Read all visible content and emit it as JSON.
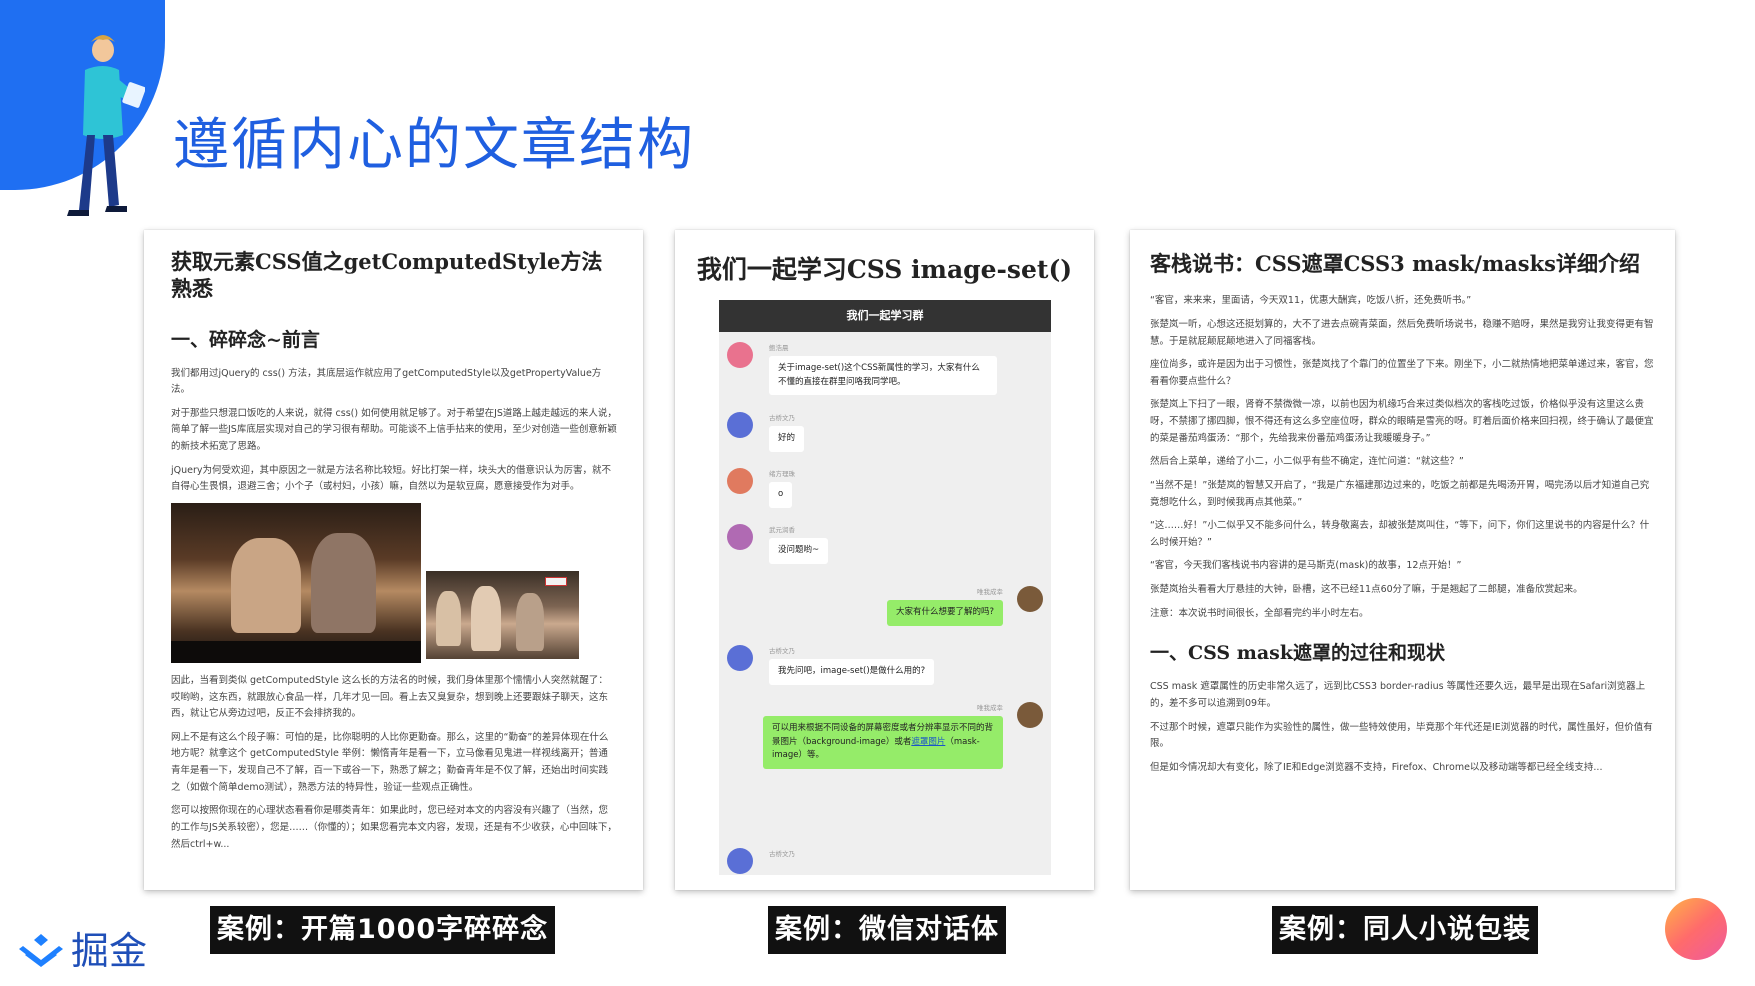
{
  "slide": {
    "title": "遵循内心的文章结构",
    "logo_text": "掘金"
  },
  "card1": {
    "title": "获取元素CSS值之getComputedStyle方法熟悉",
    "heading": "一、碎碎念~前言",
    "paragraphs": [
      "我们都用过jQuery的 css() 方法，其底层运作就应用了getComputedStyle以及getPropertyValue方法。",
      "对于那些只想混口饭吃的人来说，就得 css() 如何使用就足够了。对于希望在JS道路上越走越远的来人说，简单了解一些JS库底层实现对自己的学习很有帮助。可能谈不上信手拈来的使用，至少对创造一些创意新颖的新技术拓宽了思路。",
      "jQuery为何受欢迎，其中原因之一就是方法名称比较短。好比打架一样，块头大的借意识认为厉害，就不自得心生畏惧，退避三舍；小个子（或村妇，小孩）嘛，自然以为是软豆腐，愿意接受作为对手。",
      "因此，当看到类似 getComputedStyle 这么长的方法名的时候，我们身体里那个懦懦小人突然就醒了：哎哟哟，这东西，就跟放心食品一样，几年才见一回。看上去又臭复杂，想到晚上还要跟妹子聊天，这东西，就让它从旁边过吧，反正不会排挤我的。",
      "网上不是有这么个段子嘛：可怕的是，比你聪明的人比你更勤奋。那么，这里的“勤奋”的差异体现在什么地方呢？就拿这个 getComputedStyle 举例：懒惰青年是看一下，立马像看见鬼进一样视线离开；普通青年是看一下，发现自己不了解，百一下或谷一下，熟悉了解之；勤奋青年是不仅了解，还始出时间实践之（如做个简单demo测试），熟悉方法的特异性，验证一些观点正确性。",
      "您可以按照你现在的心理状态看看你是哪类青年：如果此时，您已经对本文的内容没有兴趣了（当然，您的工作与JS关系较密），您是……（你懂的）；如果您看完本文内容，发现，还是有不少收获，心中回味下，然后ctrl+w..."
    ]
  },
  "card2": {
    "title": "我们一起学习CSS image-set()",
    "chat_header": "我们一起学习群",
    "messages": [
      {
        "side": "left",
        "nick": "鲍浩晨",
        "text": "关于image-set()这个CSS新属性的学习，大家有什么不懂的直接在群里问咯我同学吧。",
        "color": "#e9728e"
      },
      {
        "side": "left",
        "nick": "古桥文乃",
        "text": "好的",
        "color": "#5a6fd6"
      },
      {
        "side": "left",
        "nick": "绪方理珠",
        "text": "o",
        "color": "#e07a5f"
      },
      {
        "side": "left",
        "nick": "武元润香",
        "text": "没问题哟~",
        "color": "#b06ab3"
      },
      {
        "side": "right",
        "nick": "唯我成幸",
        "text": "大家有什么想要了解的吗?",
        "color": "#7a5a3a"
      },
      {
        "side": "left",
        "nick": "古桥文乃",
        "text": "我先问吧，image-set()是做什么用的?",
        "color": "#5a6fd6"
      },
      {
        "side": "right",
        "nick": "唯我成幸",
        "text": "可以用来根据不同设备的屏幕密度或者分辨率显示不同的背景图片（background-image）或者",
        "link": "遮罩图片",
        "text2": "（mask-image）等。",
        "color": "#7a5a3a"
      },
      {
        "side": "left",
        "nick": "古桥文乃",
        "text": "",
        "color": "#5a6fd6"
      }
    ]
  },
  "card3": {
    "title": "客栈说书：CSS遮罩CSS3 mask/masks详细介绍",
    "paragraphs": [
      "“客官，来来来，里面请，今天双11，优惠大酬宾，吃饭八折，还免费听书。”",
      "张楚岚一听，心想这还挺划算的，大不了进去点碗青菜面，然后免费听场说书，稳赚不赔呀，果然是我穷让我变得更有智慧。于是就屁颠屁颠地进入了同福客栈。",
      "座位尚多，或许是因为出于习惯性，张楚岚找了个靠门的位置坐了下来。刚坐下，小二就热情地把菜单递过来，客官，您看看你要点些什么？",
      "张楚岚上下扫了一眼，肾脊不禁微微一凉，以前也因为机缘巧合来过类似档次的客栈吃过饭，价格似乎没有这里这么贵呀，不禁挪了挪四脚，恨不得还有这么多空座位呀，群众的眼睛是雪亮的呀。盯着后面价格来回扫视，终于确认了最便宜的菜是番茄鸡蛋汤：“那个，先给我来份番茄鸡蛋汤让我暖暖身子。”",
      "然后合上菜单，递给了小二，小二似乎有些不确定，连忙问道：“就这些？”",
      "“当然不是！”张楚岚的智慧又开启了，“我是广东福建那边过来的，吃饭之前都是先喝汤开胃，喝完汤以后才知道自己究竟想吃什么，到时候我再点其他菜。”",
      "“这……好！”小二似乎又不能多问什么，转身敬离去，却被张楚岚叫住，“等下，问下，你们这里说书的内容是什么？什么时候开始？”",
      "“客官，今天我们客栈说书内容讲的是马斯克(mask)的故事，12点开始！”",
      "张楚岚抬头看看大厅悬挂的大钟，卧槽，这不已经11点60分了嘛，于是翘起了二郎腿，准备欣赏起来。",
      "注意：本次说书时间很长，全部看完约半小时左右。"
    ],
    "heading": "一、CSS mask遮罩的过往和现状",
    "paragraphs2": [
      "CSS mask 遮罩属性的历史非常久远了，远到比CSS3 border-radius 等属性还要久远，最早是出现在Safari浏览器上的，差不多可以追溯到09年。",
      "不过那个时候，遮罩只能作为实验性的属性，做一些特效使用，毕竟那个年代还是IE浏览器的时代，属性虽好，但价值有限。",
      "但是如今情况却大有变化，除了IE和Edge浏览器不支持，Firefox、Chrome以及移动端等都已经全线支持..."
    ]
  },
  "captions": [
    "案例：开篇1000字碎碎念",
    "案例：微信对话体",
    "案例：同人小说包装"
  ],
  "colors": {
    "brand_blue": "#1f6ff2",
    "title_blue": "#1f5fe0",
    "wechat_green": "#95ec69"
  },
  "icons": [
    "person-reading-illustration",
    "juejin-logo-icon",
    "gradient-circle-decoration"
  ]
}
